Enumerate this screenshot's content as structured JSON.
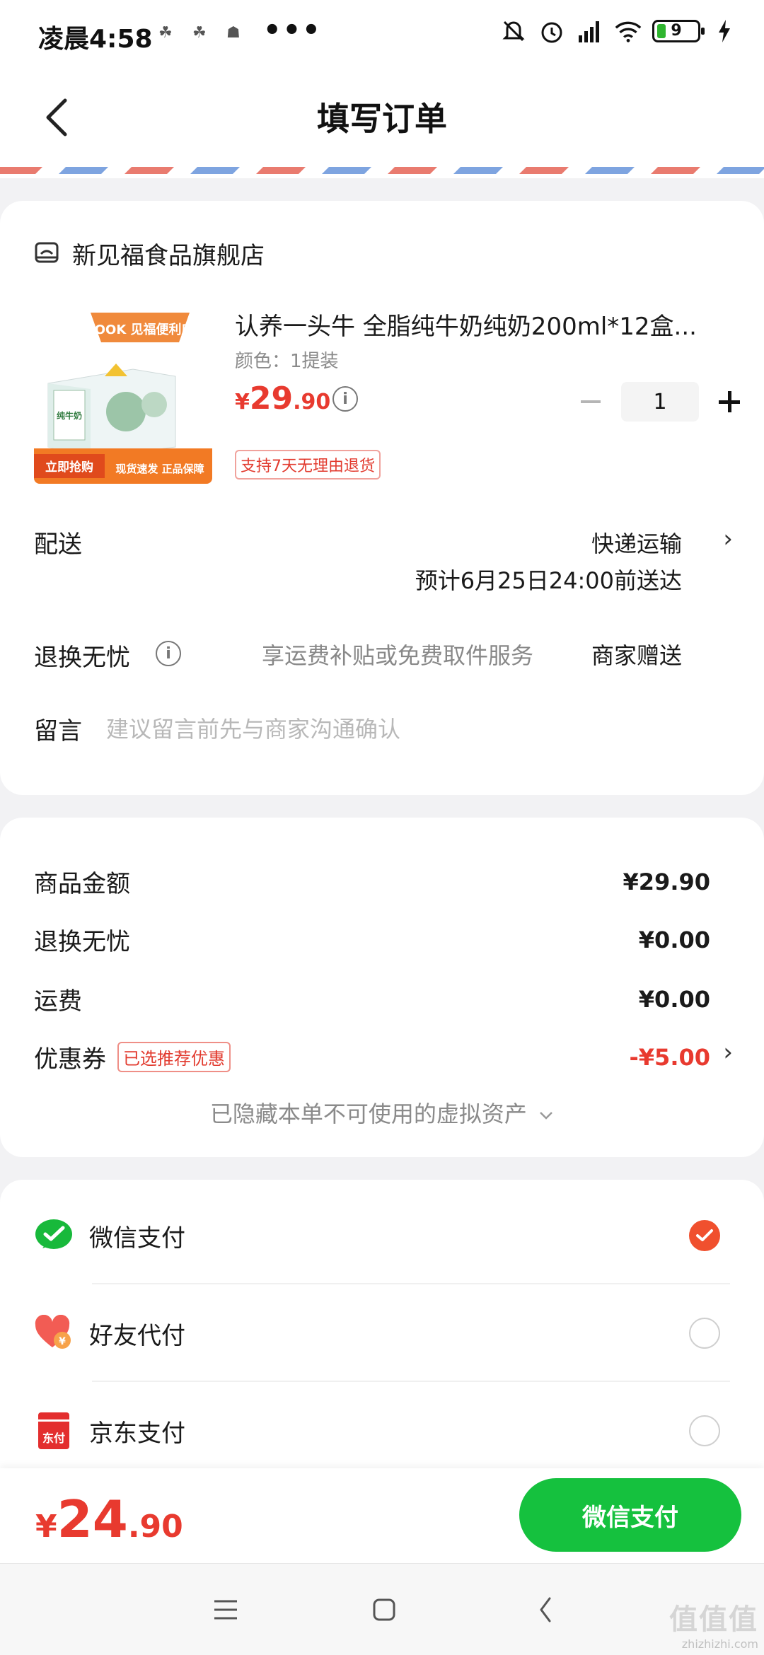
{
  "status_bar": {
    "time": "凌晨4:58",
    "battery": "9",
    "dots": "•••"
  },
  "header": {
    "title": "填写订单"
  },
  "store": {
    "name": "新见福食品旗舰店"
  },
  "product": {
    "title": "认养一头牛 全脂纯牛奶纯奶200ml*12盒...",
    "spec": "颜色：1提装",
    "price_symbol": "¥",
    "price_int": "29",
    "price_dec": ".90",
    "quantity": "1",
    "return_badge": "支持7天无理由退货",
    "image": {
      "banner": "FOOK 见福便利店",
      "box_label": "纯牛奶",
      "buy_tag": "立即抢购",
      "promo": "现货速发 正品保障"
    }
  },
  "delivery": {
    "label": "配送",
    "method": "快递运输",
    "eta": "预计6月25日24:00前送达"
  },
  "worry_free": {
    "label": "退换无忧",
    "desc": "享运费补贴或免费取件服务",
    "gift": "商家赠送"
  },
  "message": {
    "label": "留言",
    "placeholder": "建议留言前先与商家沟通确认"
  },
  "price_breakdown": {
    "goods_label": "商品金额",
    "goods_value": "¥29.90",
    "worry_label": "退换无忧",
    "worry_value": "¥0.00",
    "shipping_label": "运费",
    "shipping_value": "¥0.00",
    "coupon_label": "优惠券",
    "coupon_tag": "已选推荐优惠",
    "coupon_value": "-¥5.00",
    "hidden_assets": "已隐藏本单不可使用的虚拟资产"
  },
  "payment": {
    "methods": [
      {
        "name": "微信支付",
        "selected": true
      },
      {
        "name": "好友代付",
        "selected": false
      },
      {
        "name": "京东支付",
        "selected": false
      }
    ],
    "jd_icon_text": "东付",
    "friend_icon_text": "¥"
  },
  "bottom": {
    "total_symbol": "¥",
    "total_int": "24",
    "total_dec": ".90",
    "pay_button": "微信支付"
  },
  "watermark": {
    "line1": "值值值",
    "line2": "zhizhizhi.com"
  },
  "colors": {
    "accent_red": "#e83a2f",
    "wechat_green": "#15c13e",
    "check_orange": "#f0502e"
  }
}
